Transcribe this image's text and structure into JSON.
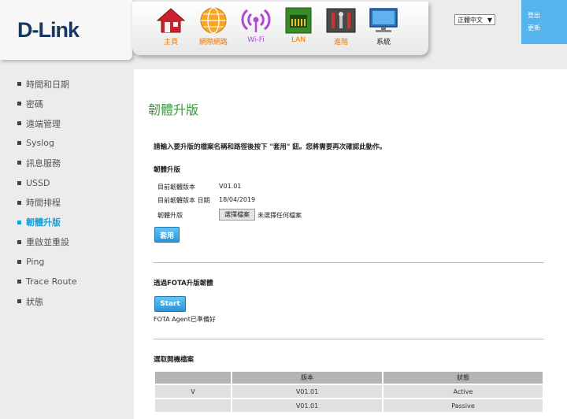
{
  "brand": {
    "logo": "D-Link"
  },
  "nav": [
    {
      "key": "home",
      "label": "主頁",
      "icon": "house-icon"
    },
    {
      "key": "internet",
      "label": "網際網路",
      "icon": "globe-icon"
    },
    {
      "key": "wifi",
      "label": "Wi-Fi",
      "icon": "wifi-icon"
    },
    {
      "key": "lan",
      "label": "LAN",
      "icon": "lan-icon"
    },
    {
      "key": "advanced",
      "label": "進階",
      "icon": "tools-icon"
    },
    {
      "key": "system",
      "label": "系統",
      "icon": "monitor-icon"
    }
  ],
  "language": {
    "selected": "正體中文"
  },
  "account": {
    "logout": "登出",
    "update": "更新"
  },
  "sidebar": {
    "items": [
      {
        "label": "時間和日期",
        "active": false
      },
      {
        "label": "密碼",
        "active": false
      },
      {
        "label": "遠端管理",
        "active": false
      },
      {
        "label": "Syslog",
        "active": false
      },
      {
        "label": "訊息服務",
        "active": false
      },
      {
        "label": "USSD",
        "active": false
      },
      {
        "label": "時間排程",
        "active": false
      },
      {
        "label": "韌體升版",
        "active": true
      },
      {
        "label": "重啟並重設",
        "active": false
      },
      {
        "label": "Ping",
        "active": false
      },
      {
        "label": "Trace Route",
        "active": false
      },
      {
        "label": "狀態",
        "active": false
      }
    ]
  },
  "main": {
    "title": "韌體升版",
    "instruction": "請輸入要升版的檔案名稱和路徑後按下 \"套用\" 鈕。您將需要再次確認此動作。",
    "firmware": {
      "section_title": "韌體升版",
      "current_version_label": "目前韌體版本",
      "current_version_value": "V01.01",
      "current_date_label": "目前韌體版本 日期",
      "current_date_value": "18/04/2019",
      "upgrade_label": "韌體升版",
      "choose_file_button": "選擇檔案",
      "no_file_text": "未選擇任何檔案",
      "apply_button": "套用"
    },
    "fota": {
      "section_title": "透過FOTA升版韌體",
      "start_button": "Start",
      "status": "FOTA Agent已準備好"
    },
    "boot": {
      "section_title": "選取開機檔案",
      "columns": [
        "",
        "版本",
        "狀態"
      ],
      "rows": [
        [
          "V",
          "V01.01",
          "Active"
        ],
        [
          "",
          "V01.01",
          "Passive"
        ]
      ]
    }
  },
  "colors": {
    "accent_blue": "#1aa0d8",
    "title_green": "#3a9a3a",
    "nav_orange": "#f07800"
  }
}
